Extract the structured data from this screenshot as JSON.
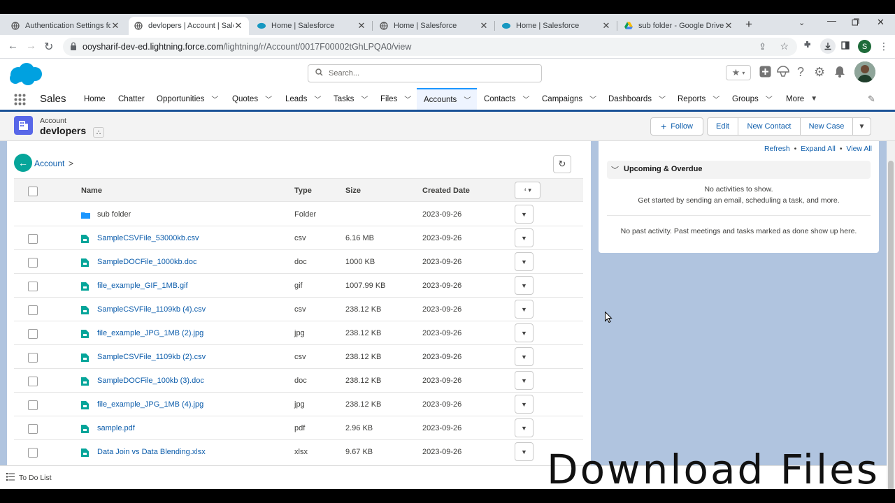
{
  "browser": {
    "tabs": [
      {
        "title": "Authentication Settings for",
        "favicon": "globe-icon",
        "active": false
      },
      {
        "title": "devlopers | Account | Sales",
        "favicon": "globe-icon",
        "active": true
      },
      {
        "title": "Home | Salesforce",
        "favicon": "salesforce-icon",
        "active": false
      },
      {
        "title": "Home | Salesforce",
        "favicon": "globe-icon",
        "active": false
      },
      {
        "title": "Home | Salesforce",
        "favicon": "salesforce-icon",
        "active": false
      },
      {
        "title": "sub folder - Google Drive",
        "favicon": "google-drive-icon",
        "active": false
      }
    ],
    "url_host": "ooysharif-dev-ed.lightning.force.com",
    "url_path": "/lightning/r/Account/0017F00002tGhLPQA0/view",
    "profile_initial": "S"
  },
  "header": {
    "search_placeholder": "Search..."
  },
  "nav": {
    "app_name": "Sales",
    "items": [
      {
        "label": "Home",
        "chevron": false
      },
      {
        "label": "Chatter",
        "chevron": false
      },
      {
        "label": "Opportunities",
        "chevron": true
      },
      {
        "label": "Quotes",
        "chevron": true
      },
      {
        "label": "Leads",
        "chevron": true
      },
      {
        "label": "Tasks",
        "chevron": true
      },
      {
        "label": "Files",
        "chevron": true
      },
      {
        "label": "Accounts",
        "chevron": true,
        "selected": true
      },
      {
        "label": "Contacts",
        "chevron": true
      },
      {
        "label": "Campaigns",
        "chevron": true
      },
      {
        "label": "Dashboards",
        "chevron": true
      },
      {
        "label": "Reports",
        "chevron": true
      },
      {
        "label": "Groups",
        "chevron": true
      },
      {
        "label": "More",
        "chevron": true
      }
    ]
  },
  "record": {
    "object_label": "Account",
    "name": "devlopers",
    "actions": {
      "follow": "Follow",
      "edit": "Edit",
      "new_contact": "New Contact",
      "new_case": "New Case"
    }
  },
  "files": {
    "breadcrumb": "Account",
    "breadcrumb_sep": ">",
    "columns": {
      "name": "Name",
      "type": "Type",
      "size": "Size",
      "created": "Created Date"
    },
    "rows": [
      {
        "name": "sub folder",
        "type": "Folder",
        "size": "",
        "date": "2023-09-26",
        "kind": "folder"
      },
      {
        "name": "SampleCSVFile_53000kb.csv",
        "type": "csv",
        "size": "6.16 MB",
        "date": "2023-09-26",
        "kind": "file"
      },
      {
        "name": "SampleDOCFile_1000kb.doc",
        "type": "doc",
        "size": "1000 KB",
        "date": "2023-09-26",
        "kind": "file"
      },
      {
        "name": "file_example_GIF_1MB.gif",
        "type": "gif",
        "size": "1007.99 KB",
        "date": "2023-09-26",
        "kind": "file"
      },
      {
        "name": "SampleCSVFile_1109kb (4).csv",
        "type": "csv",
        "size": "238.12 KB",
        "date": "2023-09-26",
        "kind": "file"
      },
      {
        "name": "file_example_JPG_1MB (2).jpg",
        "type": "jpg",
        "size": "238.12 KB",
        "date": "2023-09-26",
        "kind": "file"
      },
      {
        "name": "SampleCSVFile_1109kb (2).csv",
        "type": "csv",
        "size": "238.12 KB",
        "date": "2023-09-26",
        "kind": "file"
      },
      {
        "name": "SampleDOCFile_100kb (3).doc",
        "type": "doc",
        "size": "238.12 KB",
        "date": "2023-09-26",
        "kind": "file"
      },
      {
        "name": "file_example_JPG_1MB (4).jpg",
        "type": "jpg",
        "size": "238.12 KB",
        "date": "2023-09-26",
        "kind": "file"
      },
      {
        "name": "sample.pdf",
        "type": "pdf",
        "size": "2.96 KB",
        "date": "2023-09-26",
        "kind": "file"
      },
      {
        "name": "Data Join vs Data Blending.xlsx",
        "type": "xlsx",
        "size": "9.67 KB",
        "date": "2023-09-26",
        "kind": "file"
      }
    ]
  },
  "activity": {
    "links": {
      "refresh": "Refresh",
      "expand_all": "Expand All",
      "view_all": "View All",
      "dot": "•"
    },
    "section_title": "Upcoming & Overdue",
    "no_activity": "No activities to show.",
    "no_activity_hint": "Get started by sending an email, scheduling a task, and more.",
    "no_past": "No past activity. Past meetings and tasks marked as done show up here."
  },
  "utility": {
    "todo": "To Do List"
  },
  "overlay_caption": "Download Files",
  "colors": {
    "brand_blue": "#0b5cab",
    "nav_border": "#1b5297",
    "page_bg": "#b0c4df",
    "file_icon": "#06a59a",
    "folder_icon": "#1b96ff"
  }
}
